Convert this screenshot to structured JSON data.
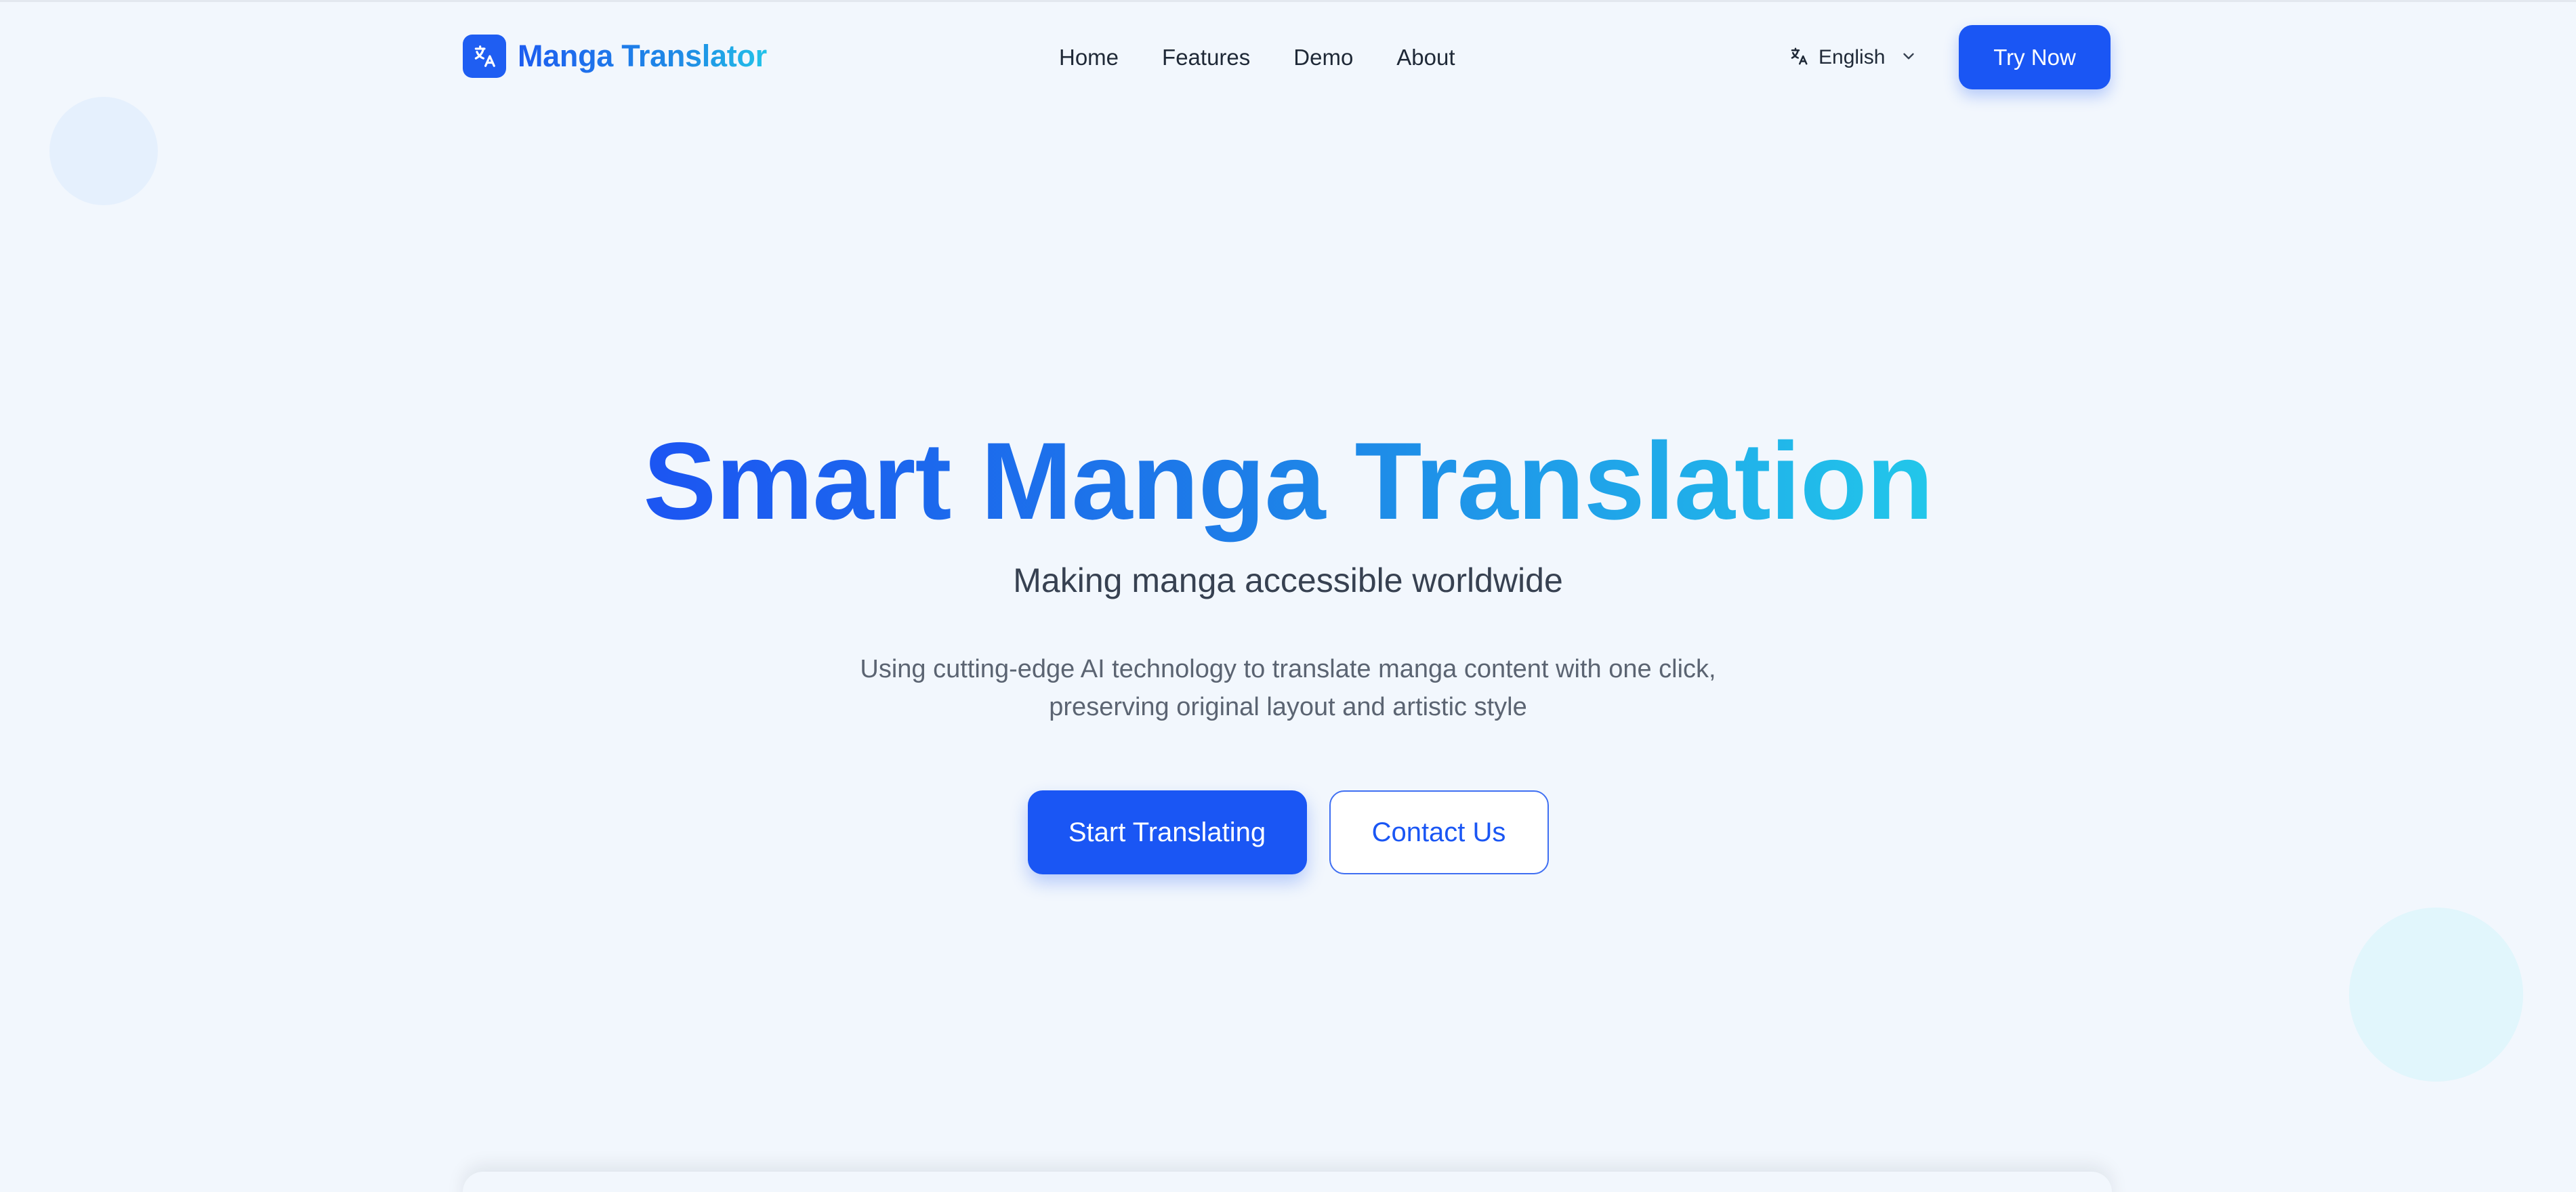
{
  "header": {
    "brand_name": "Manga Translator",
    "logo_icon": "translate-icon",
    "nav": [
      {
        "label": "Home"
      },
      {
        "label": "Features"
      },
      {
        "label": "Demo"
      },
      {
        "label": "About"
      }
    ],
    "language": {
      "icon": "translate-icon",
      "selected": "English",
      "chevron_icon": "chevron-down-icon"
    },
    "try_button_label": "Try Now"
  },
  "hero": {
    "title": "Smart Manga Translation",
    "subtitle": "Making manga accessible worldwide",
    "description_line1": "Using cutting-edge AI technology to translate manga content with one click,",
    "description_line2": "preserving original layout and artistic style",
    "primary_cta": "Start Translating",
    "secondary_cta": "Contact Us"
  },
  "colors": {
    "accent": "#1a56f4",
    "gradient_start": "#1c55f2",
    "gradient_end": "#22c7ea",
    "background": "#f2f7fd"
  }
}
